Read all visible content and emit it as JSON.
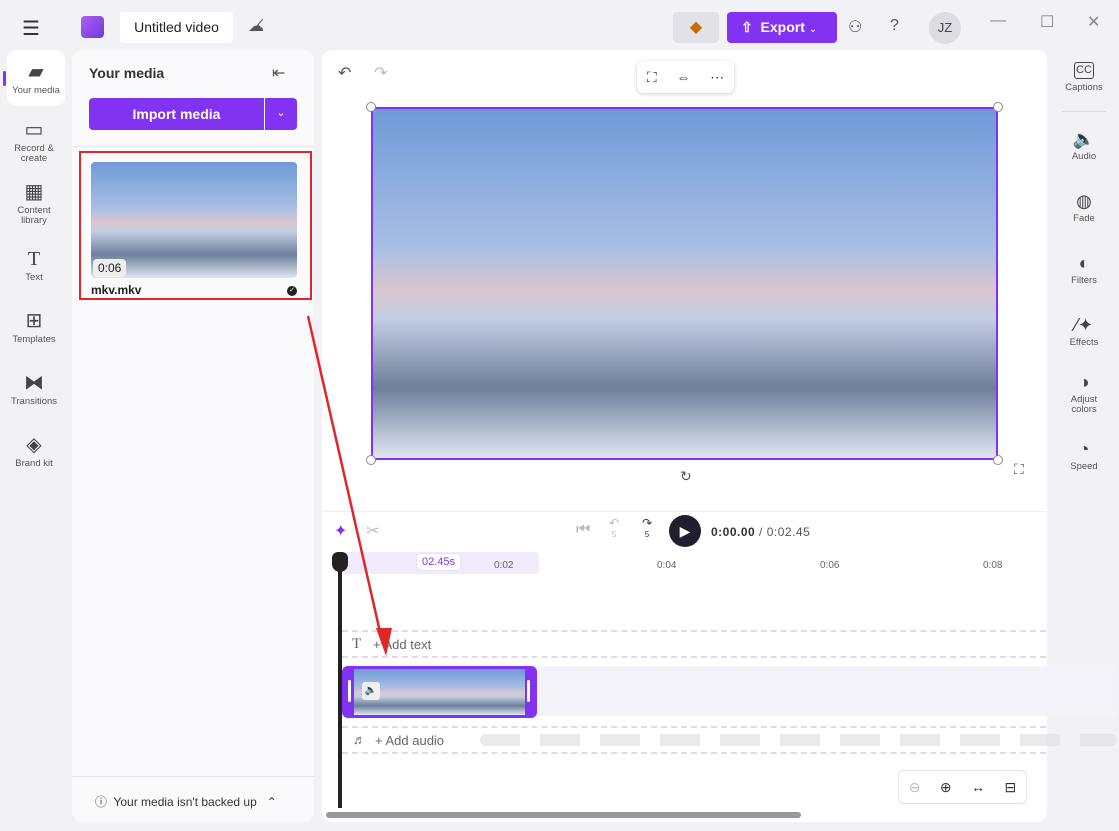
{
  "header": {
    "title": "Untitled video",
    "export_label": "Export",
    "avatar_initials": "JZ",
    "help": "?"
  },
  "left_rail": [
    {
      "label": "Your media",
      "icon": "folder-icon"
    },
    {
      "label": "Record & create",
      "icon": "camera-icon"
    },
    {
      "label": "Content library",
      "icon": "library-icon"
    },
    {
      "label": "Text",
      "icon": "text-icon"
    },
    {
      "label": "Templates",
      "icon": "templates-icon"
    },
    {
      "label": "Transitions",
      "icon": "transitions-icon"
    },
    {
      "label": "Brand kit",
      "icon": "brand-kit-icon"
    }
  ],
  "media_panel": {
    "title": "Your media",
    "import_label": "Import media",
    "item": {
      "name": "mkv.mkv",
      "duration": "0:06"
    },
    "backup_notice": "Your media isn't backed up"
  },
  "right_rail": [
    {
      "label": "Captions",
      "icon": "captions-icon"
    },
    {
      "label": "Audio",
      "icon": "audio-icon"
    },
    {
      "label": "Fade",
      "icon": "fade-icon"
    },
    {
      "label": "Filters",
      "icon": "filters-icon"
    },
    {
      "label": "Effects",
      "icon": "effects-icon"
    },
    {
      "label": "Adjust colors",
      "icon": "adjust-colors-icon"
    },
    {
      "label": "Speed",
      "icon": "speed-icon"
    }
  ],
  "playback": {
    "current": "0:00.00",
    "total": "/ 0:02.45",
    "skip": "5"
  },
  "timeline": {
    "clip_length": "02.45s",
    "ticks": [
      "0:02",
      "0:04",
      "0:06",
      "0:08"
    ],
    "add_text": "+ Add text",
    "add_audio": "+ Add audio"
  },
  "colors": {
    "accent": "#8133f1",
    "annotation": "#e0262b"
  }
}
